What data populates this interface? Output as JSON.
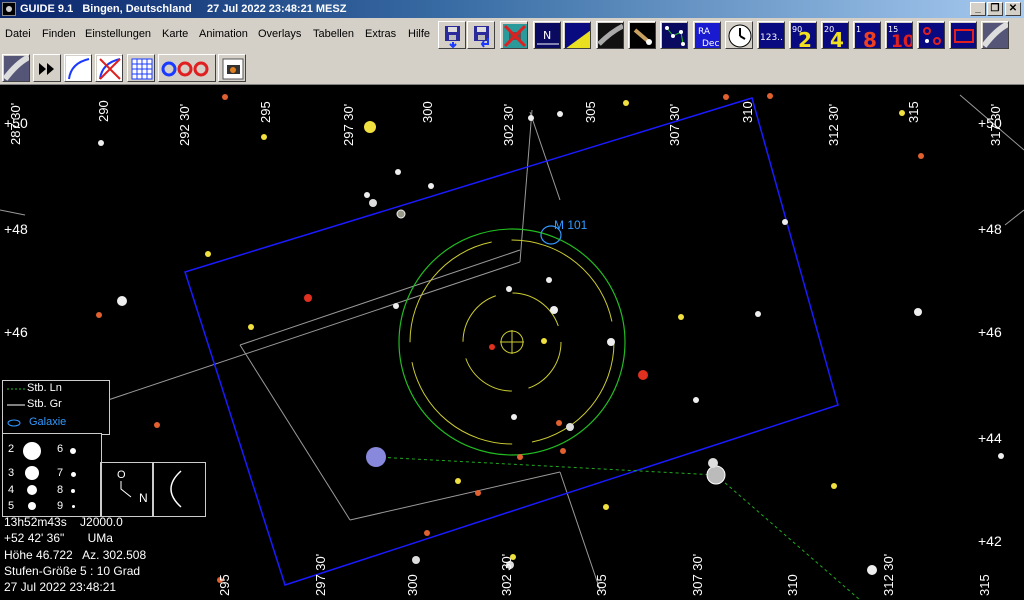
{
  "title": "GUIDE 9.1   Bingen, Deutschland     27 Jul 2022 23:48:21 MESZ",
  "window_buttons": [
    "_",
    "❐",
    "✕"
  ],
  "menu": [
    "Datei",
    "Finden",
    "Einstellungen",
    "Karte",
    "Animation",
    "Overlays",
    "Tabellen",
    "Extras",
    "Hilfe"
  ],
  "toolbar_icons": {
    "ra_dec": [
      "RA",
      "Dec"
    ],
    "numbers": [
      "123..",
      "90",
      "2",
      "20",
      "4",
      "1",
      "8",
      "15",
      "10"
    ]
  },
  "map": {
    "ra_labels_top": [
      "287 30'",
      "290",
      "292 30'",
      "295",
      "297 30'",
      "300",
      "302 30'",
      "305",
      "307 30'",
      "310",
      "312 30'",
      "315",
      "317 30'"
    ],
    "ra_labels_bottom": [
      "295",
      "297 30'",
      "300",
      "302 30'",
      "305",
      "307 30'",
      "310",
      "312 30'",
      "315"
    ],
    "dec_labels_left": [
      "+50",
      "+48",
      "+46"
    ],
    "dec_labels_right": [
      "+50",
      "+48",
      "+46",
      "+44",
      "+42"
    ],
    "object_label": "M 101"
  },
  "legend": {
    "items": [
      "Stb. Ln",
      "Stb. Gr",
      "Galaxie"
    ],
    "magnitudes": [
      "2",
      "3",
      "4",
      "5",
      "6",
      "7",
      "8",
      "9"
    ],
    "orientation": {
      "north": "N",
      "other": "O"
    }
  },
  "info": {
    "line1": "13h52m43s    J2000.0",
    "line2": "+52 42' 36\"       UMa",
    "line3": "Höhe 46.722   Az. 302.508",
    "line4": "Stufen-Größe 5 : 10 Grad",
    "line5": "27 Jul 2022 23:48:21"
  },
  "colors": {
    "titlebar": "#0a246a",
    "chrome": "#d4d0c8",
    "grid": "#c0c0c0",
    "field_blue": "#1a1aff",
    "circle_green": "#22bb22",
    "circle_yellow": "#cccc33",
    "galaxy": "#3399ff",
    "constellation_line": "#22aa22"
  }
}
